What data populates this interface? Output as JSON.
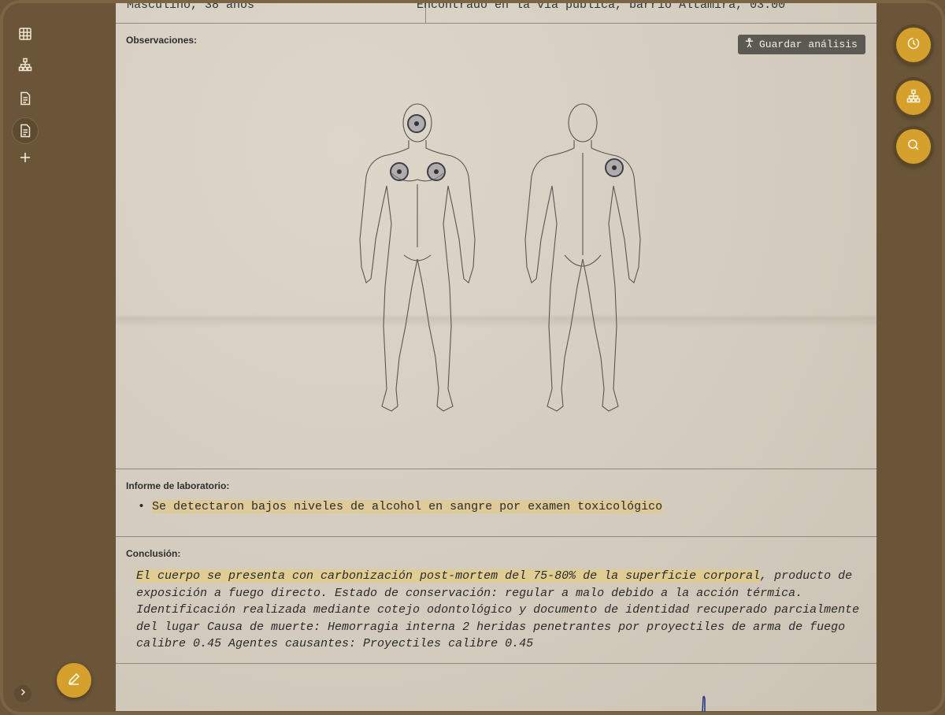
{
  "top_row": {
    "left_text": "Masculino, 38 años",
    "right_text": "Encontrado en la vía pública, barrio Altamira, 03:00"
  },
  "observations": {
    "label": "Observaciones:",
    "save_label": "Guardar análisis",
    "body_views": [
      "front",
      "back"
    ],
    "markers": [
      {
        "view": "front",
        "region": "head"
      },
      {
        "view": "front",
        "region": "right-chest"
      },
      {
        "view": "front",
        "region": "left-chest"
      },
      {
        "view": "back",
        "region": "left-shoulder"
      }
    ]
  },
  "lab_report": {
    "label": "Informe de laboratorio:",
    "items": [
      "Se detectaron bajos niveles de alcohol en sangre por examen toxicológico"
    ]
  },
  "conclusion": {
    "label": "Conclusión:",
    "highlighted": "El cuerpo se presenta con carbonización post-mortem del 75-80% de la superficie corporal",
    "text": ", producto de exposición a fuego directo. Estado de conservación: regular a malo debido a la acción térmica. Identificación realizada mediante cotejo odontológico y documento de identidad recuperado parcialmente del lugar Causa de muerte: Hemorragia interna 2 heridas penetrantes por proyectiles de arma de fuego calibre 0.45 Agentes causantes: Proyectiles calibre 0.45"
  },
  "sidebar": {
    "icons": [
      "table-icon",
      "hierarchy-icon",
      "document-icon",
      "document-active-icon",
      "plus-icon"
    ],
    "fab_icon": "pen-icon",
    "expand_icon": "chevron-right-icon"
  },
  "rail": {
    "icons": [
      "history-icon",
      "hierarchy-icon",
      "search-icon"
    ]
  },
  "colors": {
    "accent": "#d5a12c",
    "frame": "#6a5538",
    "paper": "#d6cfc2",
    "highlight": "#e8cd78"
  }
}
